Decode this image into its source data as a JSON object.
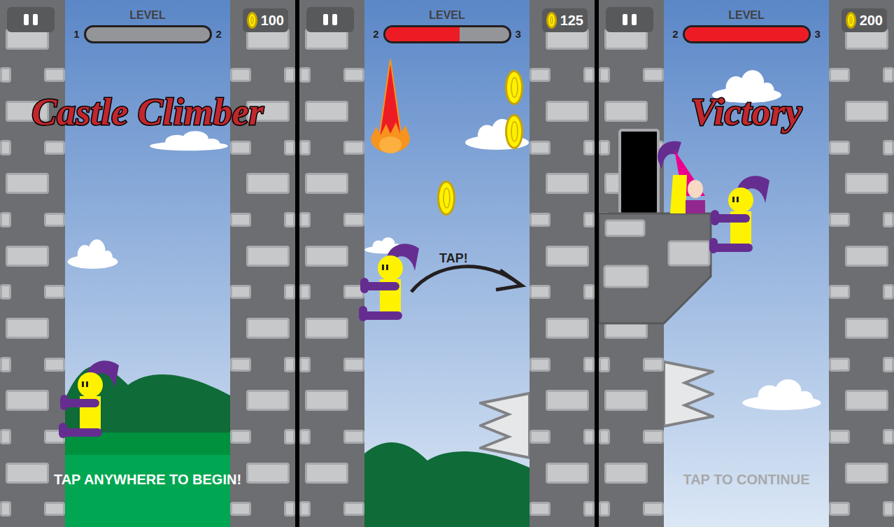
{
  "panels": [
    {
      "kind": "start",
      "hud": {
        "label": "LEVEL",
        "from": "1",
        "to": "2",
        "level": 0,
        "coins": "100"
      },
      "title": "Castle Climber",
      "prompt": {
        "text": "TAP ANYWHERE TO BEGIN!",
        "dimmed": false
      }
    },
    {
      "kind": "play",
      "hud": {
        "label": "LEVEL",
        "from": "2",
        "to": "3",
        "level": 0.6,
        "coins": "125"
      },
      "hint": "TAP!"
    },
    {
      "kind": "victory",
      "hud": {
        "label": "LEVEL",
        "from": "2",
        "to": "3",
        "level": 1,
        "coins": "200"
      },
      "title": "Victory",
      "prompt": {
        "text": "TAP TO CONTINUE",
        "dimmed": true
      }
    }
  ]
}
